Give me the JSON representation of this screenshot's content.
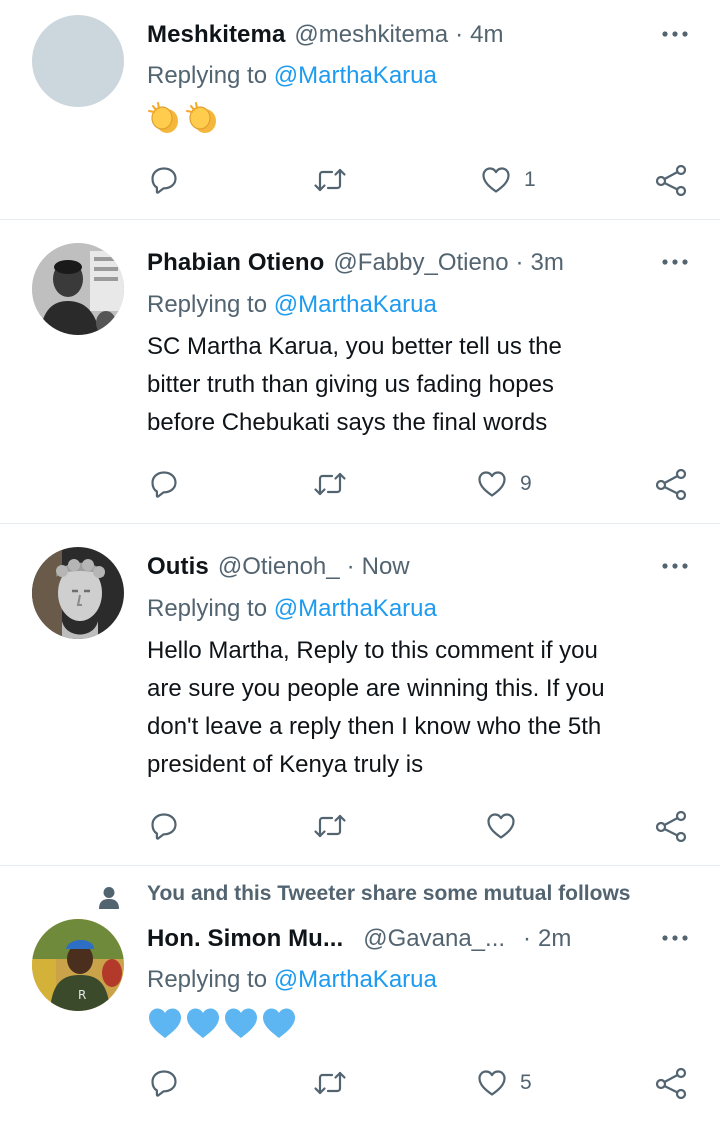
{
  "reply_prefix": "Replying to",
  "reply_target": "@MarthaKarua",
  "social_context": {
    "text": "You and this Tweeter share some mutual follows",
    "icon": "person-icon"
  },
  "icons": {
    "more": "more-dots-icon",
    "reply": "reply-icon",
    "retweet": "retweet-icon",
    "like": "heart-icon",
    "share": "share-icon"
  },
  "colors": {
    "link": "#1d9bf0",
    "secondary_text": "#536471",
    "primary_text": "#0f1419",
    "divider": "#e6ecf0",
    "heart_emoji": "#5db6f2",
    "clap_emoji": "#f5b73b"
  },
  "tweets": [
    {
      "name": "Meshkitema",
      "handle": "@meshkitema",
      "time": "4m",
      "text_lines": [],
      "emoji": [
        "clapping-hands",
        "clapping-hands"
      ],
      "likes": "1"
    },
    {
      "name": "Phabian Otieno",
      "handle": "@Fabby_Otieno",
      "time": "3m",
      "text_lines": [
        "SC Martha Karua, you better tell us the",
        "bitter truth than giving us fading hopes",
        "before Chebukati says the final words"
      ],
      "emoji": [],
      "likes": "9"
    },
    {
      "name": "Outis",
      "handle": "@Otienoh_",
      "time": "Now",
      "text_lines": [
        "Hello Martha, Reply to this comment if you",
        "are sure you people are winning this. If you",
        "don't leave a reply then I know who the 5th",
        "president of Kenya truly is"
      ],
      "emoji": [],
      "likes": ""
    },
    {
      "name": "Hon. Simon Mu...",
      "handle": "@Gavana_...",
      "time": "2m",
      "text_lines": [],
      "emoji": [
        "blue-heart",
        "blue-heart",
        "blue-heart",
        "blue-heart"
      ],
      "likes": "5"
    }
  ]
}
